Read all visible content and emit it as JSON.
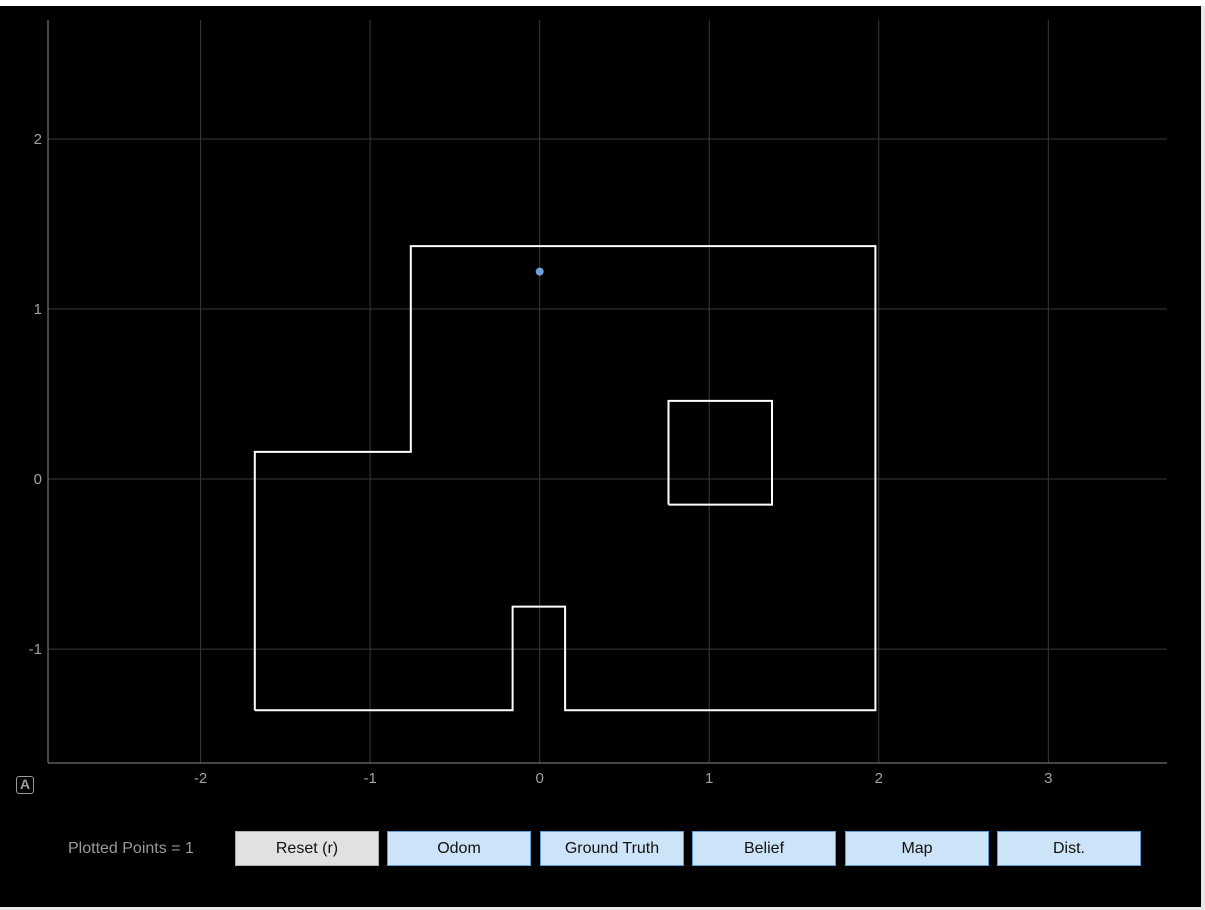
{
  "plot": {
    "auto_range_label": "A",
    "x_ticks": [
      "-2",
      "-1",
      "0",
      "1",
      "2",
      "3"
    ],
    "y_ticks": [
      "2",
      "1",
      "0",
      "-1"
    ],
    "colors": {
      "background": "#000000",
      "grid": "#3a3a3a",
      "map": "#ffffff",
      "point": "#6ea0dc",
      "tick_text": "#a0a0a0"
    }
  },
  "chart_data": {
    "type": "scatter",
    "x_range": [
      -2.9,
      3.7
    ],
    "y_range": [
      -1.67,
      2.7
    ],
    "grid": true,
    "series": [
      {
        "points": [
          {
            "x": 0.0,
            "y": 1.22
          }
        ]
      }
    ],
    "map_outline": [
      [
        -1.68,
        -1.36
      ],
      [
        -0.16,
        -1.36
      ],
      [
        -0.16,
        -0.75
      ],
      [
        0.15,
        -0.75
      ],
      [
        0.15,
        -1.36
      ],
      [
        1.98,
        -1.36
      ],
      [
        1.98,
        1.37
      ],
      [
        -0.76,
        1.37
      ],
      [
        -0.76,
        0.16
      ],
      [
        -1.68,
        0.16
      ],
      [
        -1.68,
        -1.36
      ]
    ],
    "map_obstacle": [
      [
        0.76,
        -0.15
      ],
      [
        1.37,
        -0.15
      ],
      [
        1.37,
        0.46
      ],
      [
        0.76,
        0.46
      ],
      [
        0.76,
        -0.15
      ]
    ]
  },
  "controls": {
    "points_label": "Plotted Points = 1",
    "buttons": {
      "reset": "Reset (r)",
      "odom": "Odom",
      "ground_truth": "Ground Truth",
      "belief": "Belief",
      "map": "Map",
      "dist": "Dist."
    }
  }
}
